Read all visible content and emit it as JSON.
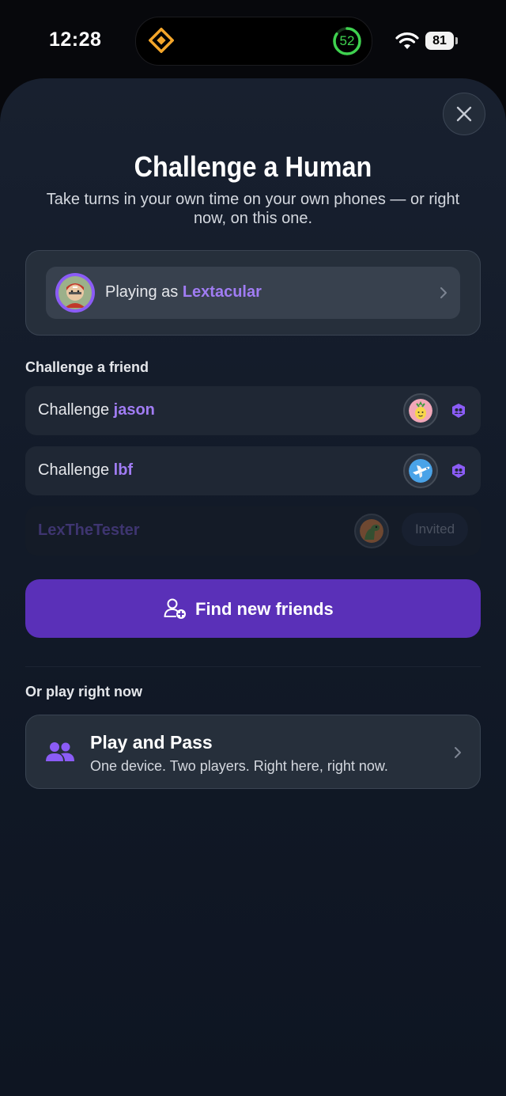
{
  "status_bar": {
    "time": "12:28",
    "activity_ring_value": "52",
    "battery": "81"
  },
  "sheet": {
    "title": "Challenge a Human",
    "subtitle": "Take turns in your own time on your own phones — or right now, on this one."
  },
  "player": {
    "prefix": "Playing as",
    "username": "Lextacular"
  },
  "friends_section": {
    "label": "Challenge a friend",
    "items": [
      {
        "prefix": "Challenge",
        "name": "jason",
        "avatar_icon": "pineapple-avatar"
      },
      {
        "prefix": "Challenge",
        "name": "lbf",
        "avatar_icon": "airplane-avatar"
      },
      {
        "name": "LexTheTester",
        "status": "Invited",
        "avatar_icon": "dinosaur-avatar"
      }
    ]
  },
  "find_friends": {
    "label": "Find new friends"
  },
  "play_now_section": {
    "label": "Or play right now",
    "title": "Play and Pass",
    "description": "One device. Two players. Right here, right now."
  },
  "colors": {
    "accent": "#a07cf3",
    "button": "#5a30b8",
    "background": "#121a28"
  }
}
